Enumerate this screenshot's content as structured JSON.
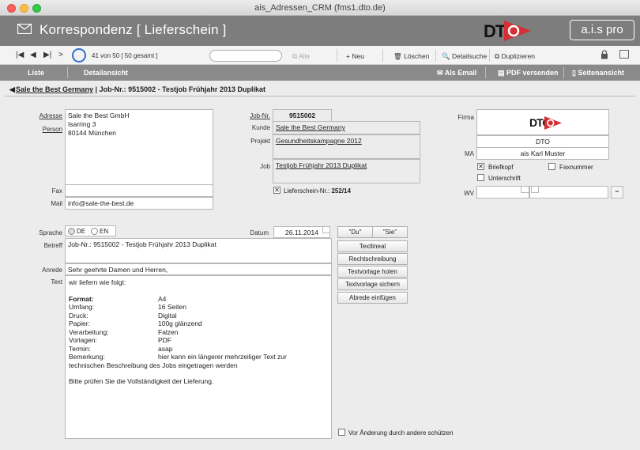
{
  "window": {
    "title": "ais_Adressen_CRM (fms1.dto.de)"
  },
  "header": {
    "title": "Korrespondenz  [ Lieferschein ]",
    "logo_text": "DTO",
    "brand": "a.i.s pro",
    "accent": "#d42f34"
  },
  "toolbar": {
    "record_count": "41 von 50  [ 50 gesamt ]",
    "search_placeholder": "",
    "alle": "Alle",
    "neu": "Neu",
    "loeschen": "Löschen",
    "detailsuche": "Detailsuche",
    "duplizieren": "Duplizieren"
  },
  "nav": {
    "liste": "Liste",
    "detailansicht": "Detailansicht",
    "als_email": "Als Email",
    "pdf_versenden": "PDF versenden",
    "seitenansicht": "Seitenansicht"
  },
  "breadcrumb": {
    "company": "Sale the Best Germany",
    "rest": " | Job-Nr.: 9515002 - Testjob Frühjahr 2013 Duplikat"
  },
  "address": {
    "label_adresse": "Adresse",
    "label_person": "Person",
    "lines": [
      "Sale the Best GmbH",
      "Isarring 3",
      "80144 München"
    ],
    "label_fax": "Fax",
    "fax": "",
    "label_mail": "Mail",
    "mail": "info@sale-the-best.de"
  },
  "job": {
    "label_jobnr": "Job-Nr.",
    "jobnr": "9515002",
    "label_kunde": "Kunde",
    "kunde": "Sale the Best Germany",
    "label_projekt": "Projekt",
    "projekt": "Gesundheitskampagne 2012",
    "label_job": "Job",
    "job": "Testjob Frühjahr 2013 Duplikat",
    "lieferschein_label": "Lieferschein-Nr.:",
    "lieferschein_nr": "252/14",
    "lieferschein_checked": "✕"
  },
  "firma": {
    "label_firma": "Firma",
    "name": "DTO",
    "label_ma": "MA",
    "ma": "ais Karl Muster",
    "briefkopf": "Briefkopf",
    "briefkopf_checked": "✕",
    "faxnummer": "Faxnummer",
    "unterschrift": "Unterschrift",
    "label_wv": "WV",
    "wv_minus": "−"
  },
  "letter": {
    "label_sprache": "Sprache",
    "lang_de": "DE",
    "lang_en": "EN",
    "label_datum": "Datum",
    "datum": "26.11.2014",
    "label_betreff": "Betreff",
    "betreff": "Job-Nr.: 9515002 - Testjob Frühjahr 2013 Duplikat",
    "label_anrede": "Anrede",
    "anrede": "Sehr geehrte Damen und Herren,",
    "label_text": "Text",
    "intro": "wir liefern wie folgt:",
    "rows": [
      {
        "k": "Format:",
        "v": "A4",
        "bold": true
      },
      {
        "k": "Umfang:",
        "v": "16 Seiten"
      },
      {
        "k": "Druck:",
        "v": "Digital"
      },
      {
        "k": "Papier:",
        "v": "100g glänzend"
      },
      {
        "k": "Verarbeitung:",
        "v": "Falzen"
      },
      {
        "k": "Vorlagen:",
        "v": "PDF"
      },
      {
        "k": "Termin:",
        "v": "asap"
      },
      {
        "k": "Bemerkung:",
        "v": "hier kann ein längerer mehrzeiliger Text zur"
      }
    ],
    "continuation": "technischen Beschreibung des Jobs eingetragen werden",
    "closing": "Bitte prüfen Sie die Vollständigkeit der Lieferung."
  },
  "side_buttons": {
    "du": "\"Du\"",
    "sie": "\"Sie\"",
    "textlineal": "Textlineal",
    "rechtschreibung": "Rechtschreibung",
    "textvorlage_holen": "Textvorlage holen",
    "textvorlage_sichern": "Textvorlage sichern",
    "abrede": "Abrede einfügen"
  },
  "protect": {
    "label": "Vor Änderung durch andere schützen"
  }
}
